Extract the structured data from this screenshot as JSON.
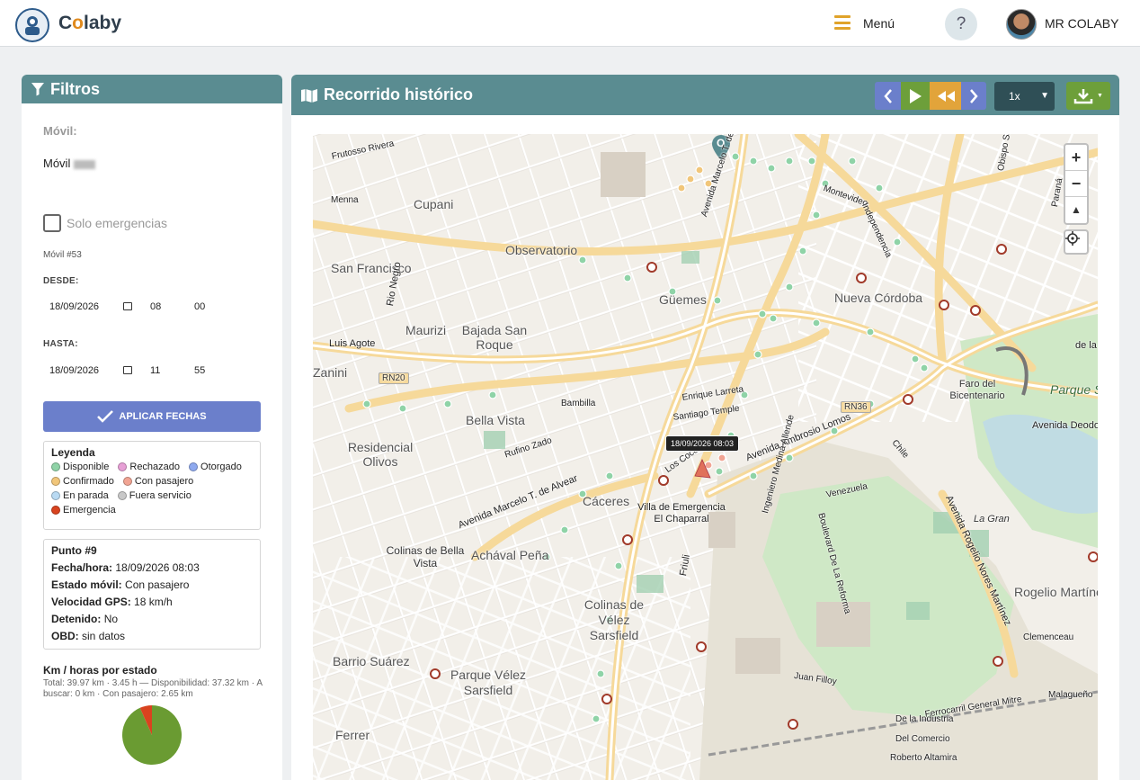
{
  "app": {
    "brand_c": "C",
    "brand_o": "o",
    "brand_rest": "laby",
    "menu_label": "Menú",
    "help": "?",
    "user": "MR COLABY"
  },
  "filters": {
    "title": "Filtros",
    "movil_label": "Móvil:",
    "movil_value": "Móvil",
    "solo_emergencias": "Solo emergencias",
    "movil_num": "Móvil #53",
    "desde_label": "DESDE:",
    "desde_date": "18/09/2026",
    "desde_hour": "08",
    "desde_min": "00",
    "hasta_label": "HASTA:",
    "hasta_date": "18/09/2026",
    "hasta_hour": "11",
    "hasta_min": "55",
    "apply_label": "APLICAR FECHAS"
  },
  "legend": {
    "title": "Leyenda",
    "items": [
      {
        "label": "Disponible",
        "color": "#8fd3a7"
      },
      {
        "label": "Rechazado",
        "color": "#e7a0d6"
      },
      {
        "label": "Otorgado",
        "color": "#8ea9ef"
      },
      {
        "label": "Confirmado",
        "color": "#f1c67a"
      },
      {
        "label": "Con pasajero",
        "color": "#f1a493"
      },
      {
        "label": "En parada",
        "color": "#b9daf3"
      },
      {
        "label": "Fuera servicio",
        "color": "#c8c8c8"
      },
      {
        "label": "Emergencia",
        "color": "#d9431f"
      }
    ]
  },
  "punto": {
    "title": "Punto #9",
    "fecha_label": "Fecha/hora:",
    "fecha_value": "18/09/2026 08:03",
    "estado_label": "Estado móvil:",
    "estado_value": "Con pasajero",
    "vel_label": "Velocidad GPS:",
    "vel_value": "18 km/h",
    "det_label": "Detenido:",
    "det_value": "No",
    "obd_label": "OBD:",
    "obd_value": "sin datos"
  },
  "km": {
    "title": "Km / horas por estado",
    "subtitle": "Total: 39.97 km · 3.45 h — Disponibilidad: 37.32 km · A buscar: 0 km · Con pasajero: 2.65 km",
    "share_disponible": 0.934,
    "share_con_pasajero": 0.066,
    "color_disponible": "#6a9b32",
    "color_con_pasajero": "#d9431f"
  },
  "recorrido": {
    "title": "Recorrido histórico",
    "speed": "1x",
    "tooltip": "18/09/2026 08:03",
    "origin_label": "O"
  },
  "map": {
    "labels": [
      "Cupani",
      "Observatorio",
      "San Francisco",
      "Güemes",
      "Nueva Córdoba",
      "Maurizi",
      "Bajada San Roque",
      "Bella Vista",
      "Residencial Olivos",
      "Cáceres",
      "Villa de Emergencia El Chaparral",
      "Colinas de Bella Vista",
      "Achával Peña",
      "Colinas de Vélez Sarsfield",
      "Barrio Suárez",
      "Parque Vélez Sarsfield",
      "Ferrer",
      "Rogelio Martínez",
      "Faro del Bicentenario",
      "Parque Sarmiento",
      "Avenida Deodoro",
      "La Gran",
      "RN20",
      "RN36",
      "Luis Agote",
      "Rio Negro",
      "Avenida Marcelo T. de Alvear",
      "Avenida Ambrosio Lomos",
      "Avenida Rogelio Nores Martínez",
      "Friuli",
      "Ferrocarril General Mitre",
      "Malagueño",
      "Juan Filloy",
      "Boulevard De La Reforma",
      "Ingeniero Medina Allende",
      "Vélez Sarsfield",
      "Avenida Marcelo T. de Alvear",
      "Montevideo",
      "Independencia",
      "Obispo Salguero",
      "Paraná",
      "Bambilla",
      "Enrique Larreta",
      "Santiago Temple",
      "Los Cocos",
      "De la Industria",
      "Del Comercio",
      "Roberto Altamira",
      "Clemenceau",
      "Venezuela",
      "Chile",
      "Rufino Zado",
      "Zanini",
      "de la",
      "Menna",
      "Frutosso Rivera"
    ]
  }
}
